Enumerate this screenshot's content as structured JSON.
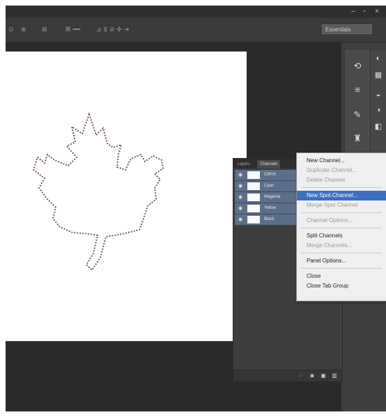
{
  "titlebar": {
    "minimize_glyph": "–",
    "restore_glyph": "▫",
    "close_glyph": "×"
  },
  "options_bar": {
    "workspace_value": "Essentials"
  },
  "channels_panel": {
    "tabs": [
      "Layers",
      "Channels"
    ],
    "channels": [
      {
        "name": "CMYK"
      },
      {
        "name": "Cyan"
      },
      {
        "name": "Magenta"
      },
      {
        "name": "Yellow"
      },
      {
        "name": "Black"
      }
    ]
  },
  "panel_menu": {
    "groups": [
      [
        {
          "label": "New Channel...",
          "disabled": false
        },
        {
          "label": "Duplicate Channel...",
          "disabled": true
        },
        {
          "label": "Delete Channel",
          "disabled": true
        }
      ],
      [
        {
          "label": "New Spot Channel...",
          "disabled": false,
          "highlighted": true
        },
        {
          "label": "Merge Spot Channel",
          "disabled": true
        }
      ],
      [
        {
          "label": "Channel Options...",
          "disabled": true
        }
      ],
      [
        {
          "label": "Split Channels",
          "disabled": false
        },
        {
          "label": "Merge Channels...",
          "disabled": true
        }
      ],
      [
        {
          "label": "Panel Options...",
          "disabled": false
        }
      ],
      [
        {
          "label": "Close",
          "disabled": false
        },
        {
          "label": "Close Tab Group",
          "disabled": false
        }
      ]
    ]
  },
  "colors": {
    "selected_row": "#5b6f8a",
    "menu_highlight": "#3d70c2",
    "app_background": "#3b3b3b"
  }
}
